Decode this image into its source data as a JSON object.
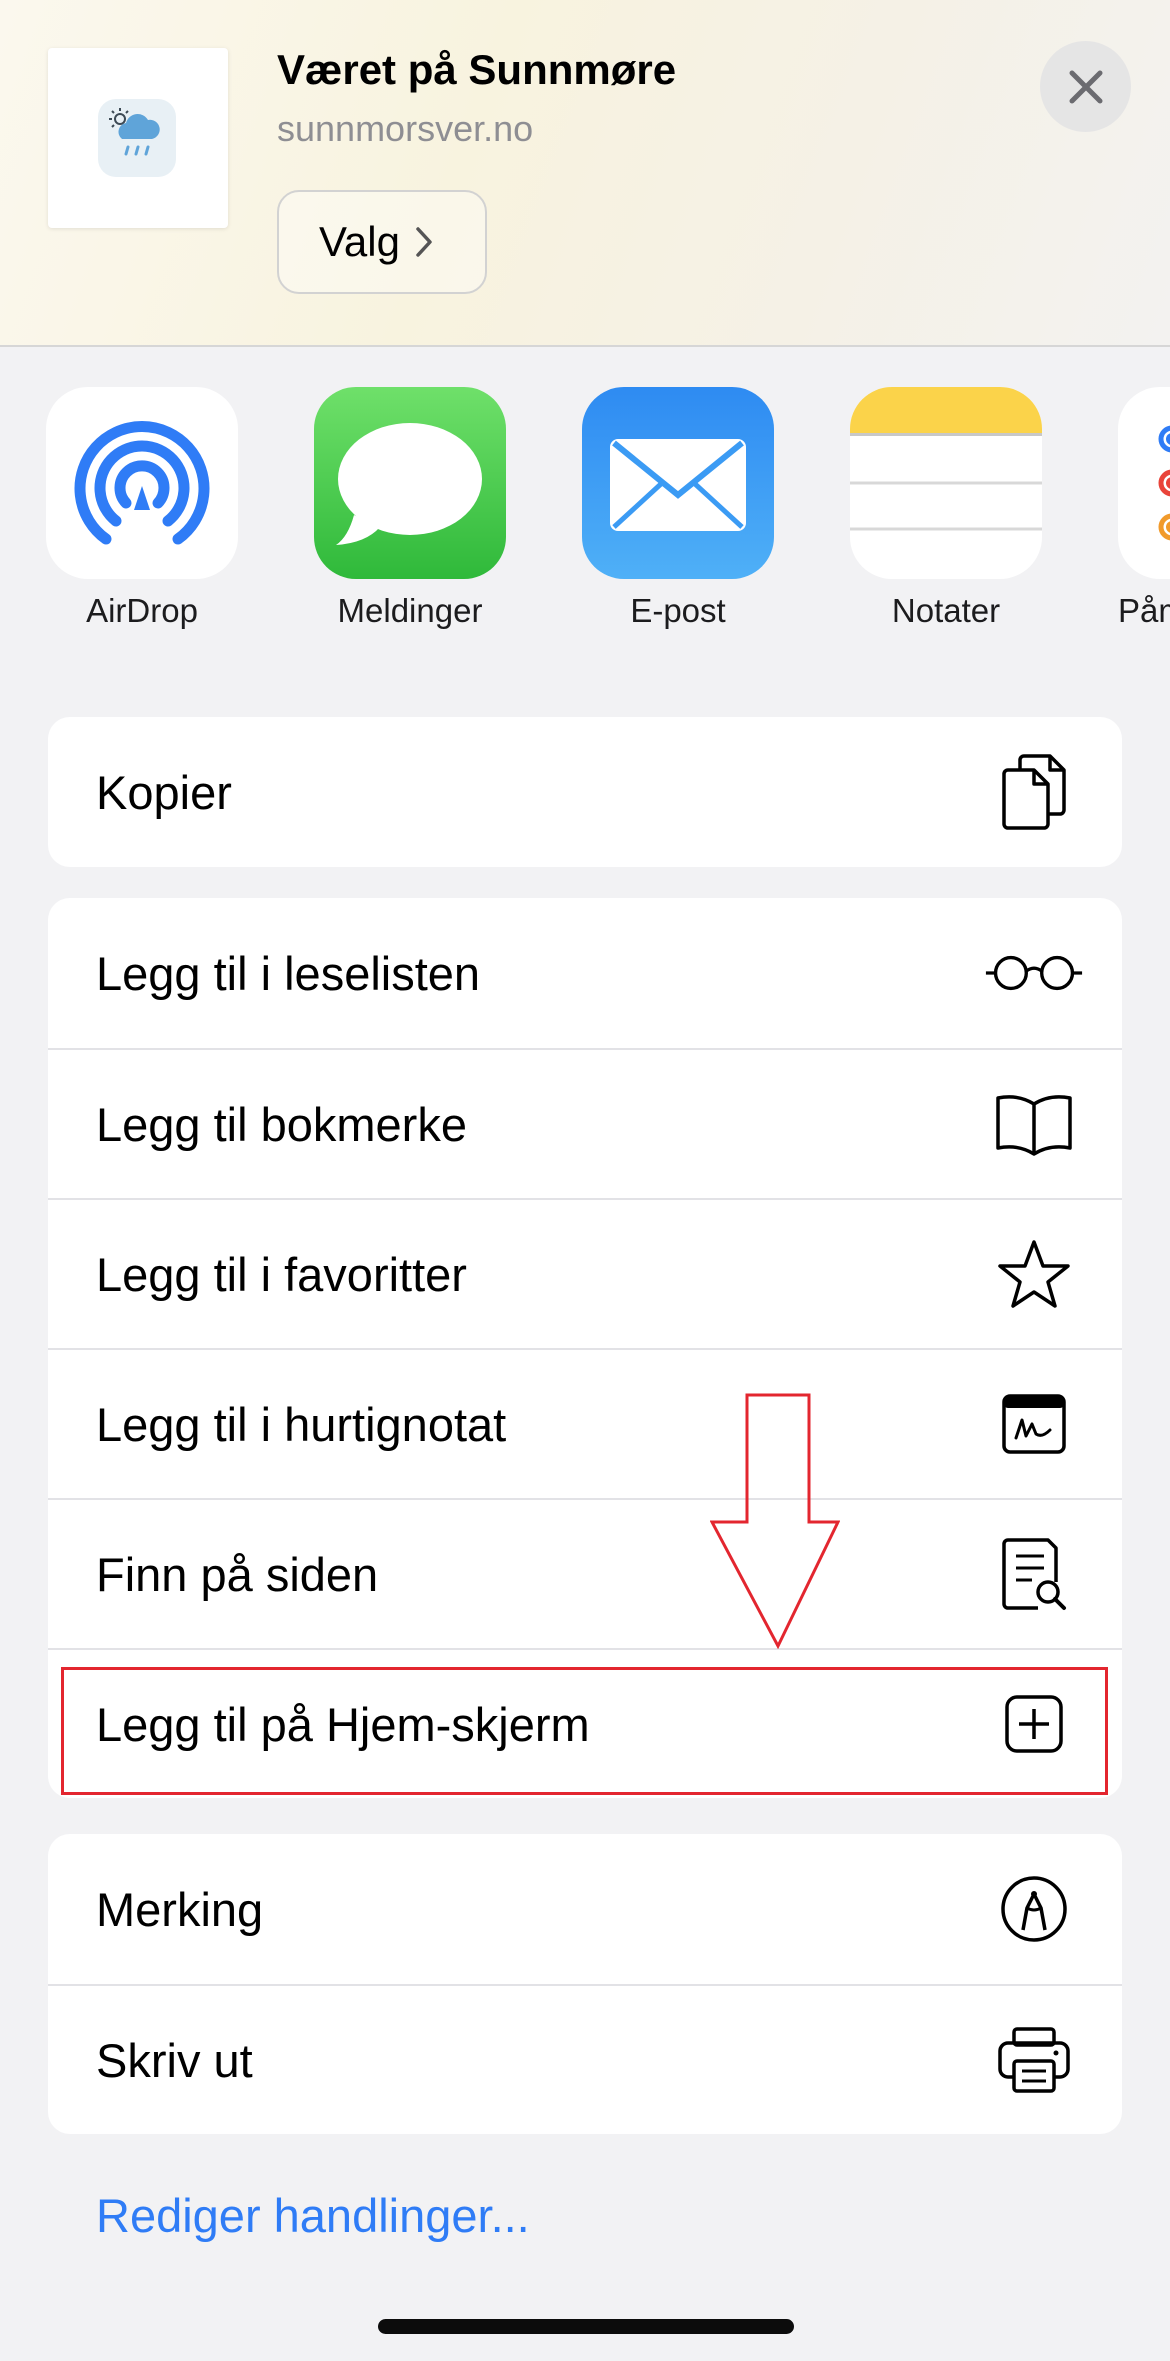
{
  "header": {
    "site_title": "Været på Sunnmøre",
    "site_url": "sunnmorsver.no",
    "options_label": "Valg"
  },
  "apps": [
    {
      "label": "AirDrop",
      "icon": "airdrop-icon"
    },
    {
      "label": "Meldinger",
      "icon": "messages-icon"
    },
    {
      "label": "E-post",
      "icon": "mail-icon"
    },
    {
      "label": "Notater",
      "icon": "notes-icon"
    },
    {
      "label": "Påminnelser",
      "icon": "reminders-icon"
    }
  ],
  "actions": {
    "group1": [
      {
        "label": "Kopier",
        "icon": "copy-icon"
      }
    ],
    "group2": [
      {
        "label": "Legg til i leselisten",
        "icon": "glasses-icon"
      },
      {
        "label": "Legg til bokmerke",
        "icon": "book-icon"
      },
      {
        "label": "Legg til i favoritter",
        "icon": "star-icon"
      },
      {
        "label": "Legg til i hurtignotat",
        "icon": "quick-note-icon"
      },
      {
        "label": "Finn på siden",
        "icon": "find-on-page-icon"
      },
      {
        "label": "Legg til på Hjem-skjerm",
        "icon": "add-square-icon"
      }
    ],
    "group3": [
      {
        "label": "Merking",
        "icon": "markup-icon"
      },
      {
        "label": "Skriv ut",
        "icon": "printer-icon"
      }
    ]
  },
  "edit_actions_label": "Rediger handlinger...",
  "colors": {
    "link": "#2f7cf6",
    "highlight": "#e3262f",
    "sheet_background": "#f2f2f4"
  }
}
